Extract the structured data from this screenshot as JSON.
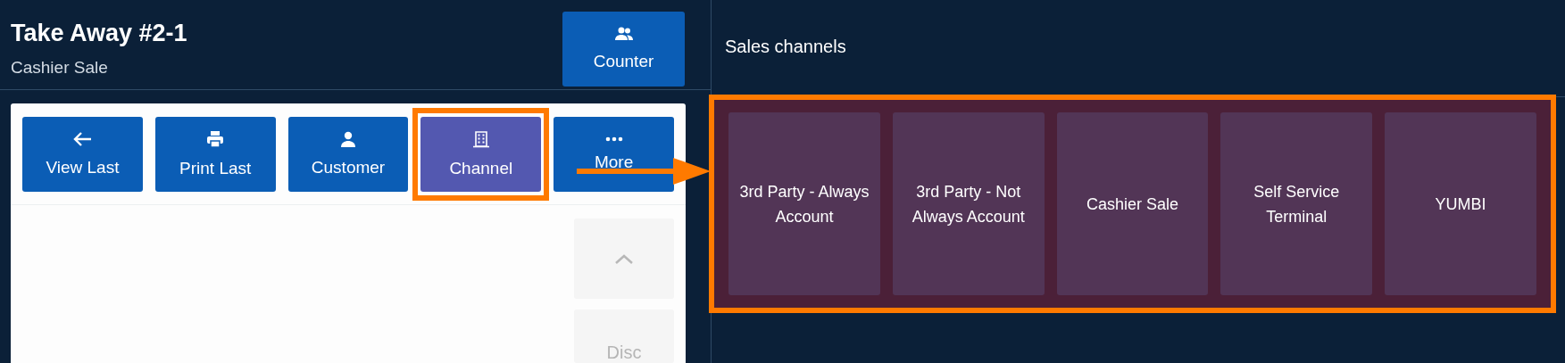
{
  "order": {
    "title": "Take Away #2-1",
    "subtitle": "Cashier Sale"
  },
  "counter_button": {
    "label": "Counter"
  },
  "actions": [
    {
      "kind": "back",
      "label": "View Last",
      "selected": false
    },
    {
      "kind": "print",
      "label": "Print Last",
      "selected": false
    },
    {
      "kind": "person",
      "label": "Customer",
      "selected": false
    },
    {
      "kind": "building",
      "label": "Channel",
      "selected": true
    },
    {
      "kind": "more",
      "label": "More",
      "selected": false
    }
  ],
  "side_buttons": [
    {
      "kind": "scroll-up"
    },
    {
      "kind": "text",
      "label": "Disc"
    }
  ],
  "sales_channels": {
    "title": "Sales channels",
    "channels": [
      "3rd Party - Always Account",
      "3rd Party - Not Always Account",
      "Cashier Sale",
      "Self Service Terminal",
      "YUMBI"
    ]
  }
}
